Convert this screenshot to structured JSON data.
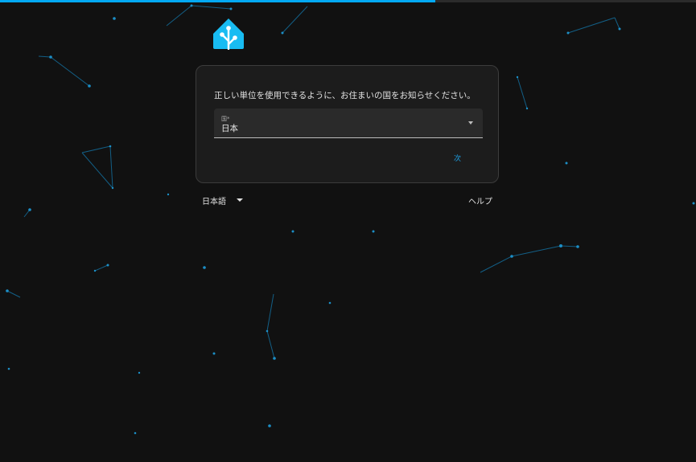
{
  "progress": {
    "percent": 62.5
  },
  "logo": {
    "icon": "home-assistant-logo-icon",
    "color": "#18bcf2"
  },
  "card": {
    "prompt": "正しい単位を使用できるように、お住まいの国をお知らせください。",
    "country_field": {
      "label": "国*",
      "value": "日本"
    },
    "next_label": "次"
  },
  "footer": {
    "language": "日本語",
    "help": "ヘルプ"
  },
  "colors": {
    "background": "#111111",
    "card": "#1c1c1c",
    "accent": "#03a9f4",
    "network": "#1c8fc7"
  }
}
